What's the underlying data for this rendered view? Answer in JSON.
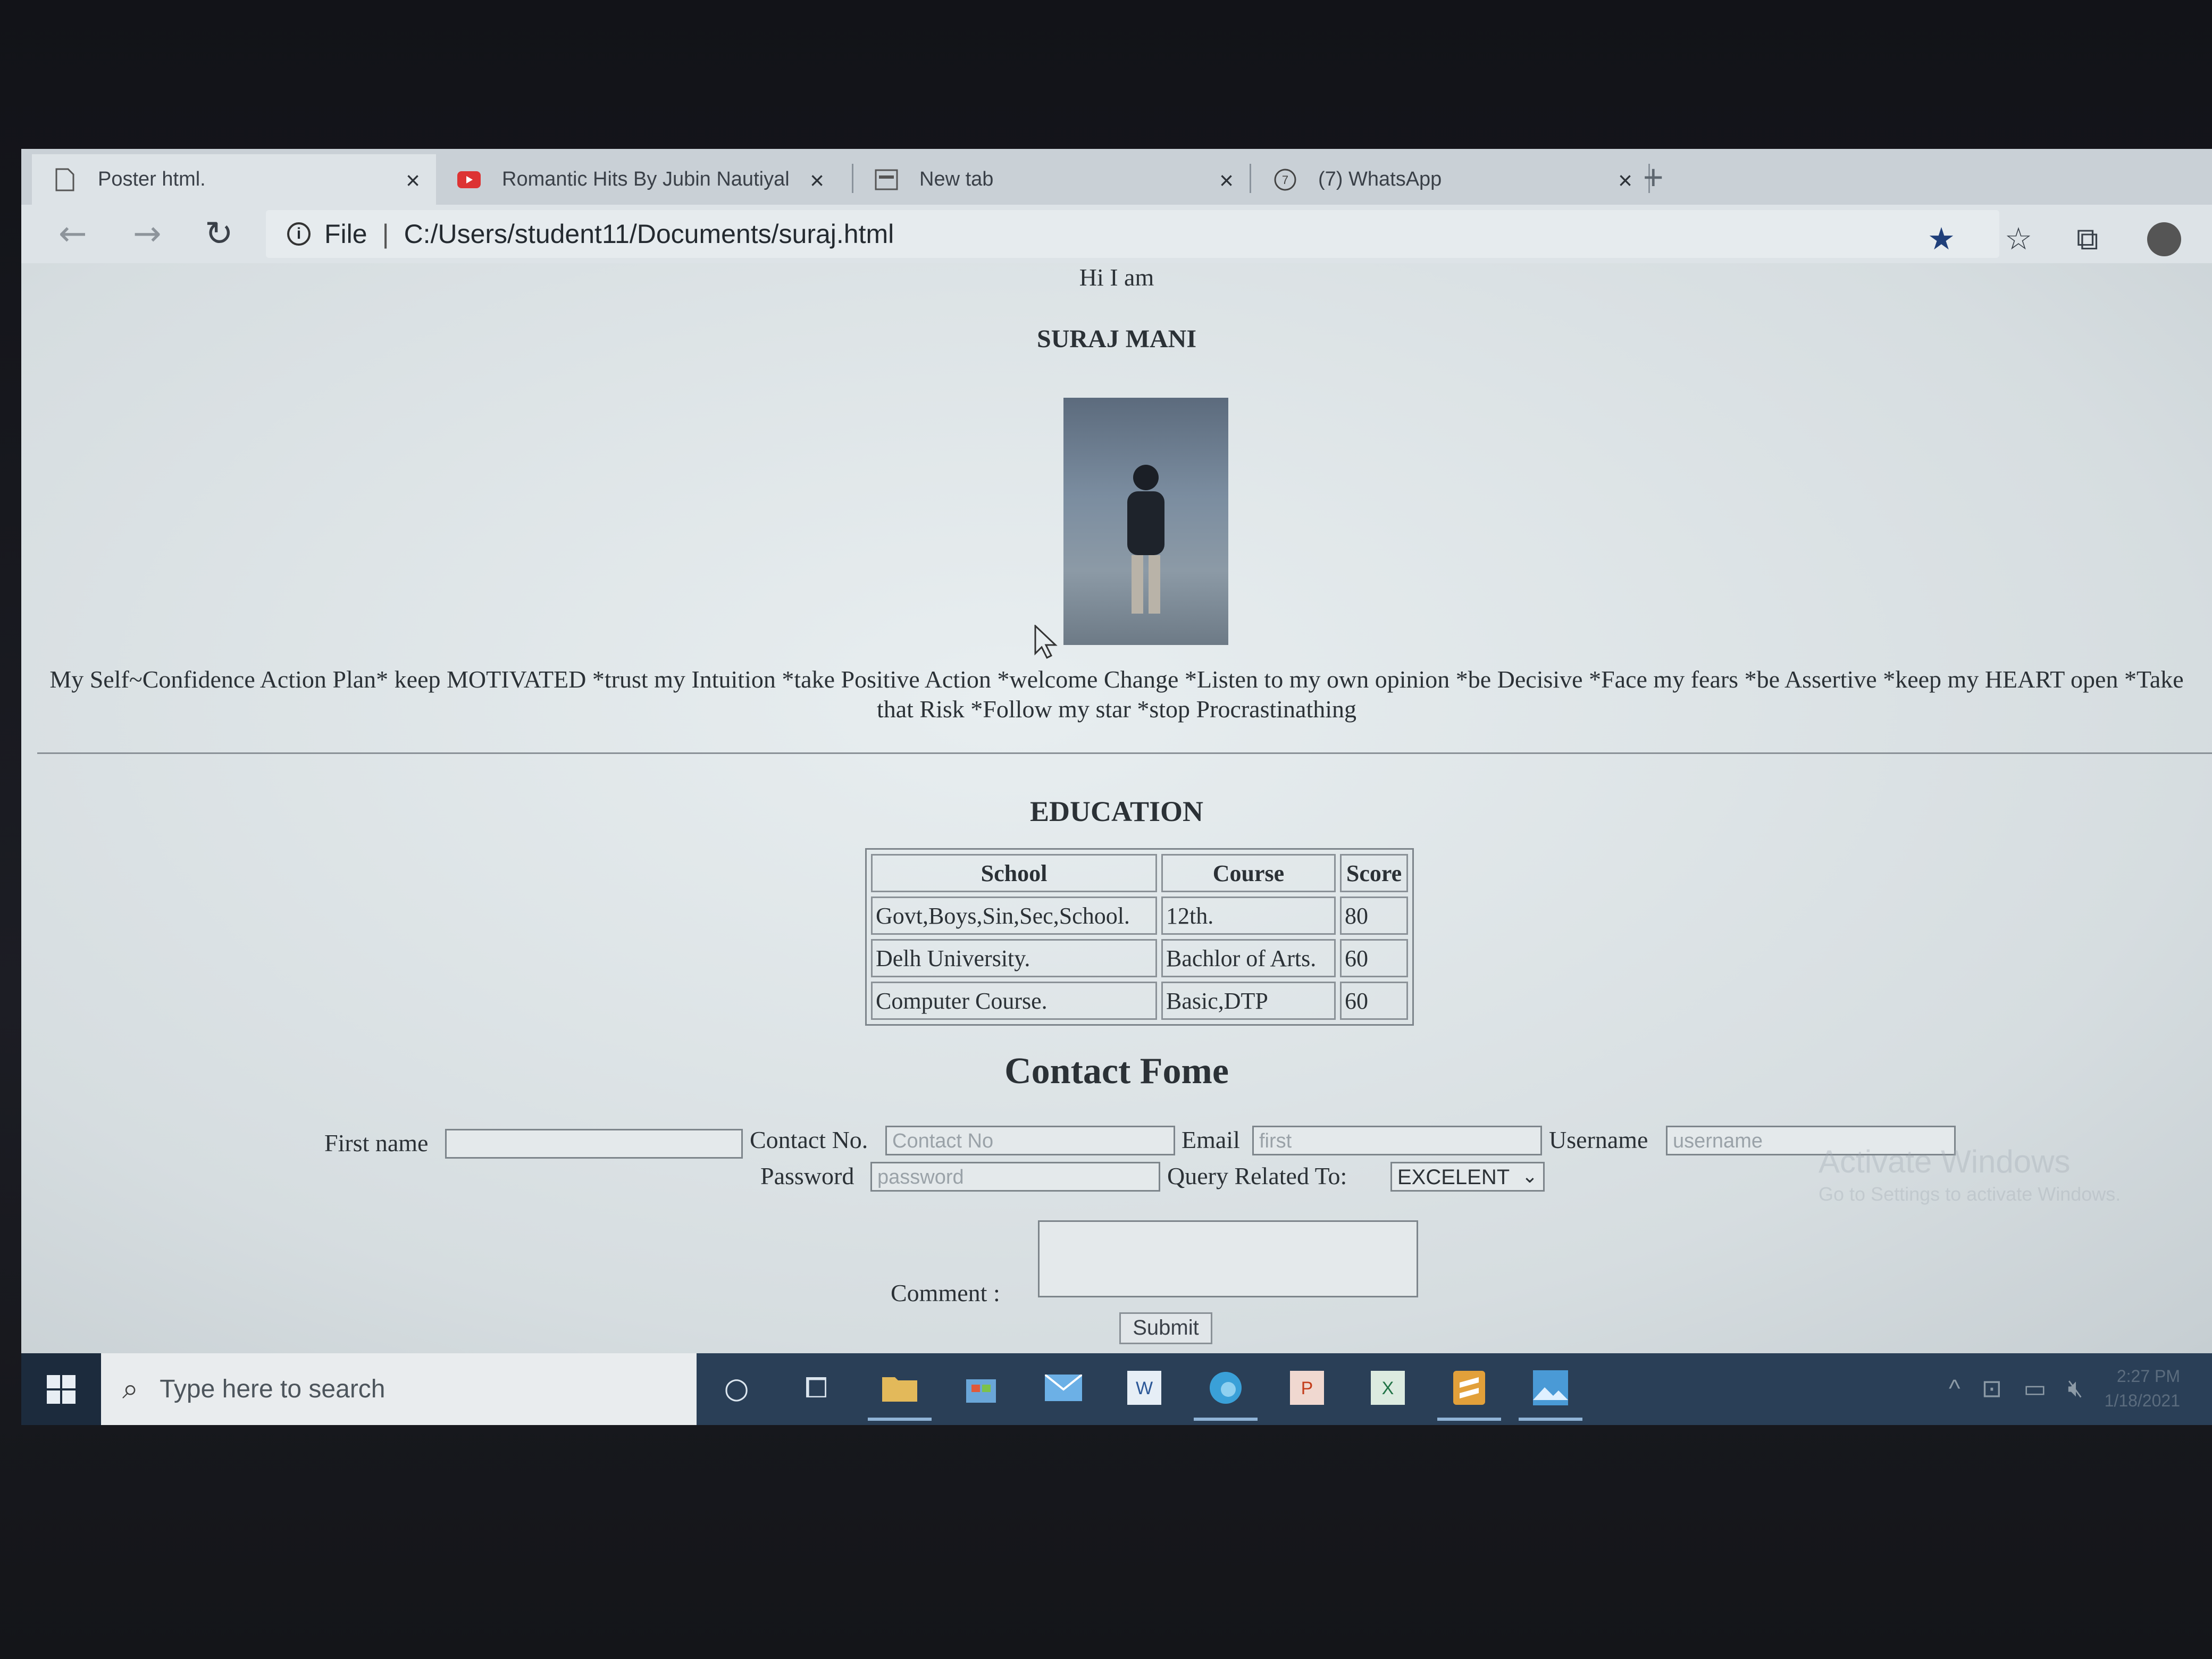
{
  "browser": {
    "tabs": [
      {
        "label": "Poster html.",
        "icon": "page-icon",
        "active": true
      },
      {
        "label": "Romantic Hits By Jubin Nautiyal",
        "icon": "youtube-icon",
        "active": false
      },
      {
        "label": "New tab",
        "icon": "newtab-icon",
        "active": false
      },
      {
        "label": "(7) WhatsApp",
        "icon": "whatsapp-icon",
        "active": false
      }
    ],
    "close_glyph": "×",
    "newtab_glyph": "+",
    "address_scheme": "File",
    "address_url": "C:/Users/student11/Documents/suraj.html"
  },
  "page": {
    "intro": "Hi I am",
    "name": "SURAJ MANI",
    "plan_text": "My Self~Confidence Action Plan* keep MOTIVATED *trust my Intuition *take Positive Action *welcome Change *Listen to my own opinion *be Decisive *Face my fears *be Assertive *keep my HEART open *Take that Risk *Follow my star *stop Procrastinathing",
    "education": {
      "title": "EDUCATION",
      "headers": [
        "School",
        "Course",
        "Score"
      ],
      "rows": [
        [
          "Govt,Boys,Sin,Sec,School.",
          "12th.",
          "80"
        ],
        [
          "Delh University.",
          "Bachlor of Arts.",
          "60"
        ],
        [
          "Computer Course.",
          "Basic,DTP",
          "60"
        ]
      ]
    },
    "contact": {
      "title": "Contact Fome",
      "first_name_label": "First name",
      "first_name_value": "",
      "contact_label": "Contact No.",
      "contact_placeholder": "Contact No",
      "email_label": "Email",
      "email_placeholder": "first",
      "username_label": "Username",
      "username_placeholder": "username",
      "password_label": "Password",
      "password_placeholder": "password",
      "query_label": "Query Related To:",
      "query_value": "EXCELENT",
      "comment_label": "Comment :",
      "submit_label": "Submit"
    },
    "watermark_line1": "Activate Windows",
    "watermark_line2": "Go to Settings to activate Windows."
  },
  "taskbar": {
    "search_placeholder": "Type here to search",
    "apps": [
      "cortana-icon",
      "task-view-icon",
      "file-explorer-icon",
      "store-icon",
      "mail-icon",
      "word-icon",
      "edge-icon",
      "powerpoint-icon",
      "excel-icon",
      "sublime-icon",
      "photos-icon"
    ],
    "time": "2:27 PM",
    "date": "1/18/2021"
  }
}
